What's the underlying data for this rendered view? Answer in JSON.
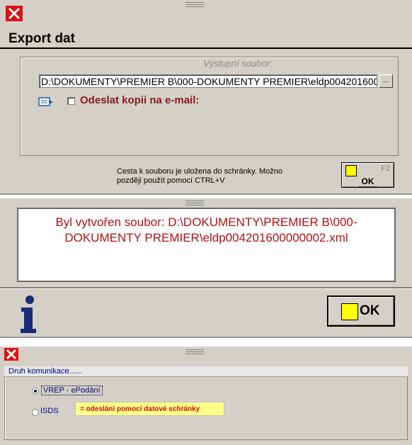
{
  "export_dialog": {
    "title": "Export dat",
    "output_label": "Výstupní soubor:",
    "path_value": "D:\\DOKUMENTY\\PREMIER B\\000-DOKUMENTY PREMIER\\eldp004201600000002.xml",
    "browse_label": "...",
    "email_label": "Odeslat kopii na e-mail:",
    "email_checked": false,
    "info_text": "Cesta k souboru je uložena do schránky. Možno později použít pomocí CTRL+V",
    "ok_key": "F2",
    "ok_label": "OK"
  },
  "message_dialog": {
    "message": "Byl vytvořen soubor: D:\\DOKUMENTY\\PREMIER B\\000-DOKUMENTY PREMIER\\eldp004201600000002.xml",
    "ok_label": "OK",
    "icon": "info-icon"
  },
  "comm_dialog": {
    "group_label": "Druh komunikace......",
    "options": [
      {
        "label": "VREP - ePodání",
        "selected": true
      },
      {
        "label": "ISDS",
        "selected": false
      }
    ],
    "tooltip": "= odeslání pomocí datové schránky"
  },
  "colors": {
    "close_red": "#dd1111",
    "label_red": "#8b1a1a",
    "message_red": "#b01010",
    "button_yellow": "#ffff00",
    "tooltip_yellow": "#ffff88"
  }
}
